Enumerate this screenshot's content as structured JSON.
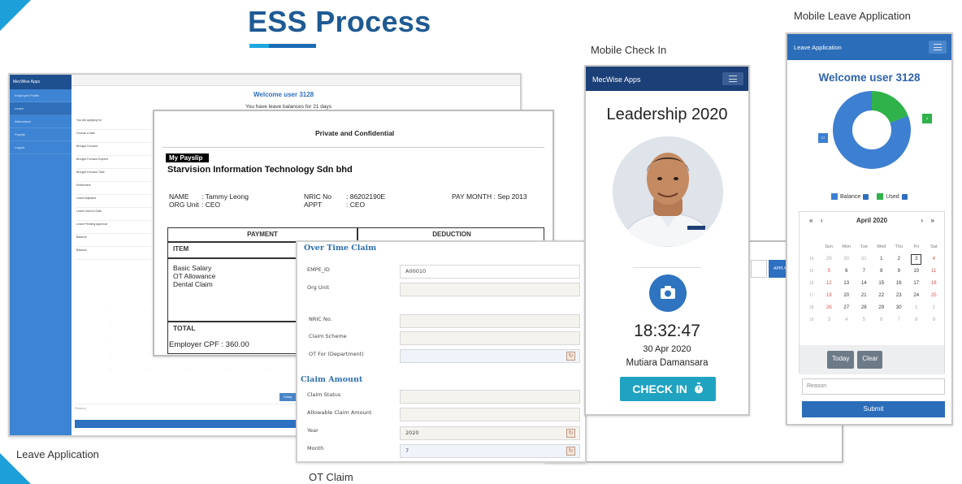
{
  "title": "ESS Process",
  "captions": {
    "leave_application": "Leave Application",
    "ot_claim": "OT Claim",
    "mobile_check_in": "Mobile Check In",
    "mobile_leave_application": "Mobile Leave Application"
  },
  "leave_window": {
    "brand": "MecWise Apps",
    "nav": [
      "Employee Profile",
      "Leave",
      "Attendance",
      "Payslip",
      "Logout"
    ],
    "welcome": "Welcome user 3128",
    "subtitle": "You have leave balances for 21 days",
    "form_labels": [
      "You are applying for",
      "Choose a date",
      "Brought Forward",
      "Brought Forward Expired",
      "Brought Forward Total",
      "Entitlement",
      "Leave Adjusted",
      "Leave Used to Date",
      "Leave Pending approval",
      "Balance",
      "Balance"
    ],
    "reason": "Reason",
    "mini_button": "Today"
  },
  "payslip": {
    "confidential": "Private and Confidential",
    "tag": "My Payslip",
    "company": "Starvision Information Technology Sdn bhd",
    "name_label": "NAME",
    "name_value": ": Tammy Leong",
    "org_label": "ORG Unit",
    "org_value": ": CEO",
    "nric_label": "NRIC No",
    "nric_value": ": 86202190E",
    "appt_label": "APPT",
    "appt_value": ": CEO",
    "pay_month": "PAY MONTH :  Sep 2013",
    "payment": "PAYMENT",
    "deduction": "DEDUCTION",
    "item": "ITEM",
    "lines": [
      "Basic Salary",
      "OT Allowance",
      "Dental Claim"
    ],
    "total": "TOTAL",
    "employer_cpf": "Employer CPF  :  360.00"
  },
  "sliver": {
    "button": "APPLY"
  },
  "ot_claim": {
    "section1": "Over Time Claim",
    "section2": "Claim Amount",
    "labels": {
      "emp_id": "EMPE_ID",
      "org_unit": "Org Unit",
      "nric": "NRIC No.",
      "claim_scheme": "Claim Scheme",
      "ot_for": "OT For (Department)",
      "claim_status": "Claim Status",
      "allowable": "Allowable Claim Amount",
      "year": "Year",
      "month": "Month"
    },
    "values": {
      "emp_id": "A00010",
      "year": "2020",
      "month": "7"
    }
  },
  "mobile_check_in": {
    "app_name": "MecWise Apps",
    "heading": "Leadership 2020",
    "time": "18:32:47",
    "date": "30 Apr 2020",
    "location": "Mutiara Damansara",
    "button": "CHECK IN"
  },
  "mobile_leave": {
    "header": "Leave Application",
    "welcome": "Welcome user 3128",
    "donut_balance_label": "17",
    "donut_used_label": "4",
    "legend_balance": "Balance",
    "legend_used": "Used",
    "colors": {
      "balance": "#3d7fd0",
      "used": "#2fb24a"
    },
    "calendar": {
      "month": "April 2020",
      "nav_prev_year": "«",
      "nav_prev": "‹",
      "nav_next": "›",
      "nav_next_year": "»",
      "weekdays": [
        "Sun",
        "Mon",
        "Tue",
        "Wed",
        "Thu",
        "Fri",
        "Sat"
      ],
      "weeks": [
        {
          "wk": "14",
          "days": [
            "29",
            "30",
            "31",
            "1",
            "2",
            "3",
            "4"
          ]
        },
        {
          "wk": "15",
          "days": [
            "5",
            "6",
            "7",
            "8",
            "9",
            "10",
            "11"
          ]
        },
        {
          "wk": "16",
          "days": [
            "12",
            "13",
            "14",
            "15",
            "16",
            "17",
            "18"
          ]
        },
        {
          "wk": "17",
          "days": [
            "19",
            "20",
            "21",
            "22",
            "23",
            "24",
            "25"
          ]
        },
        {
          "wk": "18",
          "days": [
            "26",
            "27",
            "28",
            "29",
            "30",
            "1",
            "2"
          ]
        },
        {
          "wk": "19",
          "days": [
            "3",
            "4",
            "5",
            "6",
            "7",
            "8",
            "9"
          ]
        }
      ],
      "today_button": "Today",
      "clear_button": "Clear"
    },
    "reason_placeholder": "Reason",
    "submit": "Submit"
  }
}
